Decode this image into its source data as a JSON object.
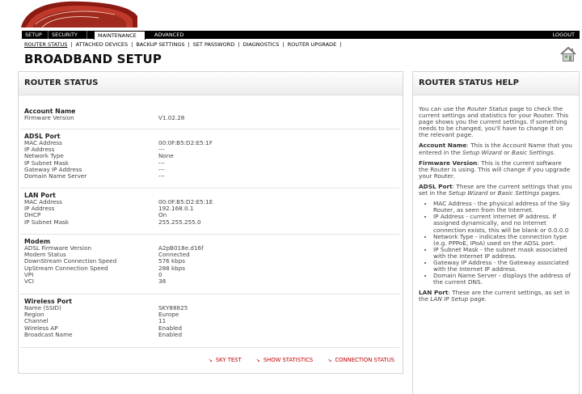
{
  "nav": {
    "tabs": [
      "SETUP",
      "SECURITY",
      "MAINTENANCE",
      "ADVANCED"
    ],
    "active_tab": "MAINTENANCE",
    "logout": "LOGOUT"
  },
  "subnav": [
    "ROUTER STATUS",
    "ATTACHED DEVICES",
    "BACKUP SETTINGS",
    "SET PASSWORD",
    "DIAGNOSTICS",
    "ROUTER UPGRADE"
  ],
  "page_title": "BROADBAND SETUP",
  "main": {
    "title": "ROUTER STATUS",
    "sections": {
      "account": {
        "title": "Account Name",
        "rows": [
          [
            "Firmware Version",
            "V1.02.28"
          ]
        ]
      },
      "adsl": {
        "title": "ADSL Port",
        "rows": [
          [
            "MAC Address",
            "00:0F:B5:D2:E5:1F"
          ],
          [
            "IP Address",
            "---"
          ],
          [
            "Network Type",
            "None"
          ],
          [
            "IP Subnet Mask",
            "---"
          ],
          [
            "Gateway IP Address",
            "---"
          ],
          [
            "Domain Name Server",
            "---"
          ]
        ]
      },
      "lan": {
        "title": "LAN Port",
        "rows": [
          [
            "MAC Address",
            "00:0F:B5:D2:E5:1E"
          ],
          [
            "IP Address",
            "192.168.0.1"
          ],
          [
            "DHCP",
            "On"
          ],
          [
            "IP Subnet Mask",
            "255.255.255.0"
          ]
        ]
      },
      "modem": {
        "title": "Modem",
        "rows": [
          [
            "ADSL Firmware Version",
            "A2pB018e.d16f"
          ],
          [
            "Modem Status",
            "Connected"
          ],
          [
            "DownStream Connection Speed",
            "576 kbps"
          ],
          [
            "UpStream Connection Speed",
            "288 kbps"
          ],
          [
            "VPI",
            "0"
          ],
          [
            "VCI",
            "38"
          ]
        ]
      },
      "wireless": {
        "title": "Wireless Port",
        "rows": [
          [
            "Name (SSID)",
            "SKY88825"
          ],
          [
            "Region",
            "Europe"
          ],
          [
            "Channel",
            "11"
          ],
          [
            "Wireless AP",
            "Enabled"
          ],
          [
            "Broadcast Name",
            "Enabled"
          ]
        ]
      }
    },
    "actions": [
      "SKY TEST",
      "SHOW STATISTICS",
      "CONNECTION STATUS"
    ]
  },
  "help": {
    "title": "ROUTER STATUS HELP",
    "intro_1": "You can use the ",
    "intro_em": "Router Status",
    "intro_2": " page to check the current settings and statistics for your Router. This page shows you the current settings. If something needs to be changed, you'll have to change it on the relevant page.",
    "account_label": "Account Name",
    "account_1": ": This is the Account Name that you entered in the ",
    "account_em1": "Setup Wizard",
    "account_2": " or ",
    "account_em2": "Basic Settings",
    "account_3": ".",
    "firmware_label": "Firmware Version",
    "firmware_text": ": This is the current software the Router is using. This will change if you upgrade your Router.",
    "adsl_label": "ADSL Port",
    "adsl_1": ": These are the current settings that you set in the ",
    "adsl_em1": "Setup Wizard",
    "adsl_2": " or ",
    "adsl_em2": "Basic Settings",
    "adsl_3": " pages.",
    "bullets": [
      "MAC Address - the physical address of the Sky Router, as seen from the Internet.",
      "IP Address - current Internet IP address. If assigned dynamically, and no Internet connection exists, this will be blank or 0.0.0.0",
      "Network Type - indicates the connection type (e.g. PPPoE, IPoA) used on the ADSL port.",
      "IP Subnet Mask - the subnet mask associated with the Internet IP address.",
      "Gateway IP Address - the Gateway associated with the Internet IP address.",
      "Domain Name Server - displays the address of the current DNS."
    ],
    "lan_label": "LAN Port",
    "lan_1": ": These are the current settings, as set in the ",
    "lan_em": "LAN IP Setup",
    "lan_2": " page."
  }
}
